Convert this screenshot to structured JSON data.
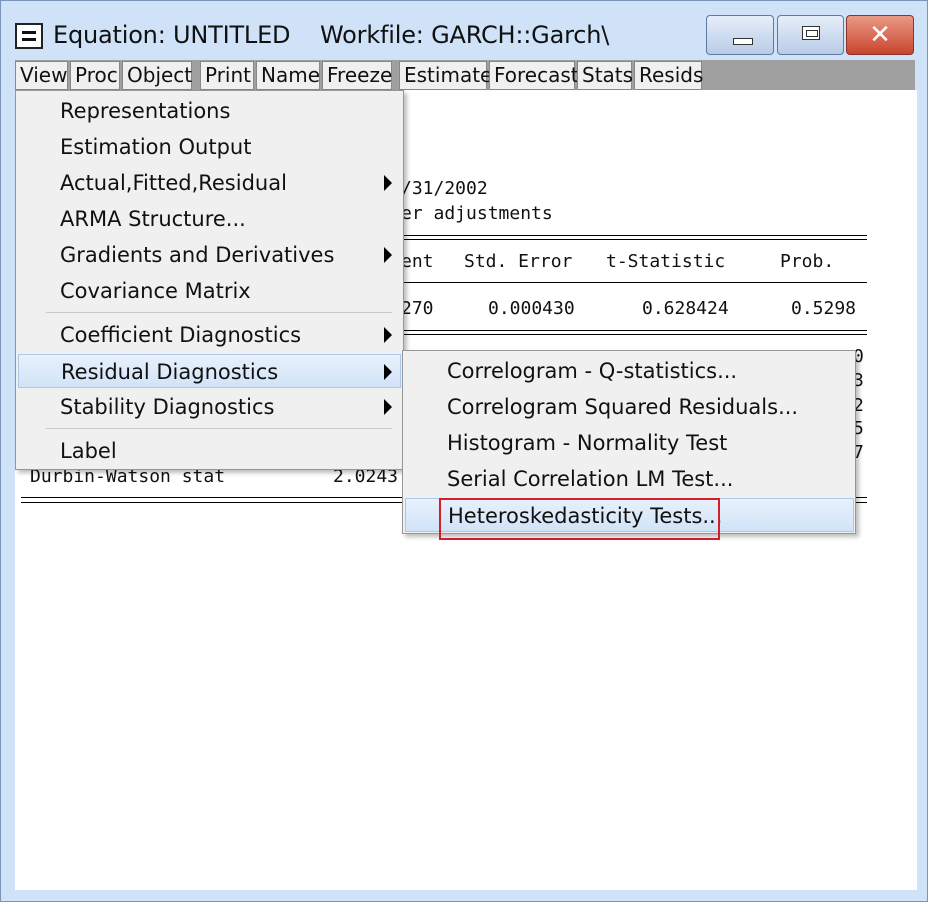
{
  "window": {
    "title": "Equation: UNTITLED    Workfile: GARCH::Garch\\"
  },
  "toolbar": {
    "buttons": [
      "View",
      "Proc",
      "Object",
      "Print",
      "Name",
      "Freeze",
      "Estimate",
      "Forecast",
      "Stats",
      "Resids"
    ]
  },
  "output": {
    "date_fragment": "/31/2002",
    "adjust_fragment": "er adjustments",
    "headers": {
      "coef": "ent",
      "std_error": "Std. Error",
      "t_stat": "t-Statistic",
      "prob": "Prob."
    },
    "row": {
      "coef": "270",
      "std_error": "0.000430",
      "t_stat": "0.628424",
      "prob": "0.5298"
    },
    "right_digits": [
      "0",
      "3",
      "2",
      "5",
      "7"
    ],
    "dw_label": "Durbin-Watson stat",
    "dw_value": "2.0243"
  },
  "view_menu": {
    "items": [
      {
        "label": "Representations",
        "has_submenu": false
      },
      {
        "label": "Estimation Output",
        "has_submenu": false
      },
      {
        "label": "Actual,Fitted,Residual",
        "has_submenu": true
      },
      {
        "label": "ARMA Structure...",
        "has_submenu": false
      },
      {
        "label": "Gradients and Derivatives",
        "has_submenu": true
      },
      {
        "label": "Covariance Matrix",
        "has_submenu": false
      },
      {
        "label": "Coefficient Diagnostics",
        "has_submenu": true
      },
      {
        "label": "Residual Diagnostics",
        "has_submenu": true,
        "highlighted": true
      },
      {
        "label": "Stability Diagnostics",
        "has_submenu": true
      },
      {
        "label": "Label",
        "has_submenu": false
      }
    ]
  },
  "residual_submenu": {
    "items": [
      {
        "label": "Correlogram - Q-statistics..."
      },
      {
        "label": "Correlogram Squared Residuals..."
      },
      {
        "label": "Histogram - Normality Test"
      },
      {
        "label": "Serial Correlation LM Test..."
      },
      {
        "label": "Heteroskedasticity Tests...",
        "highlighted": true
      }
    ]
  },
  "colors": {
    "window_frame": "#cfe2f8",
    "close_button": "#c9442e",
    "menu_highlight": "#d2e3f8",
    "callout_box": "#d0202a"
  }
}
